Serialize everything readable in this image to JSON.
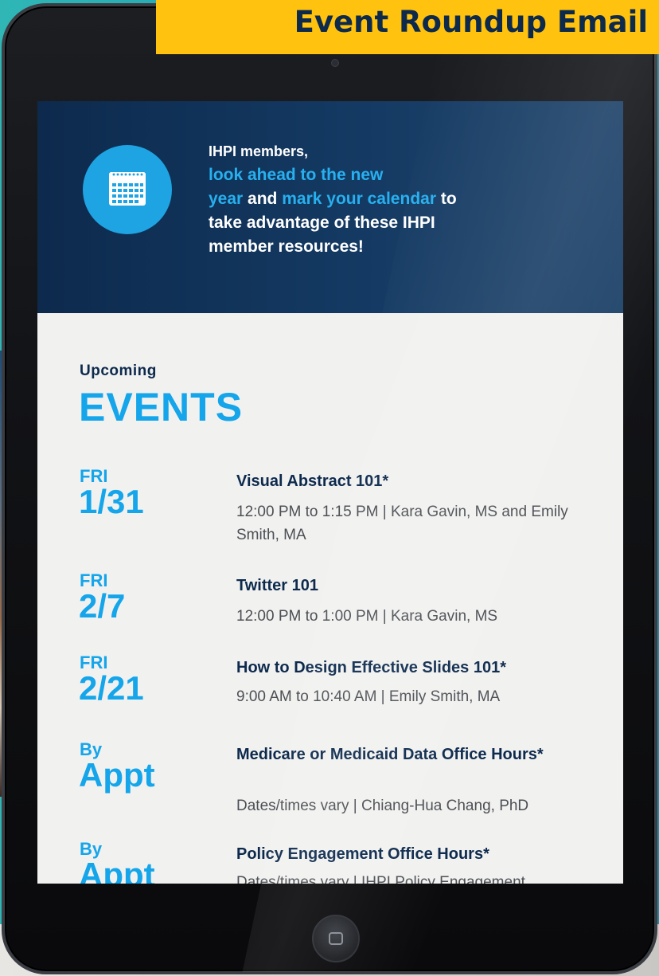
{
  "banner": {
    "title": "Event Roundup Email",
    "background": "#ffc20e",
    "text_color": "#0d2a4d"
  },
  "hero": {
    "line1": "IHPI members,",
    "line2": "look ahead to the new",
    "line3_a": "year",
    "line3_b": " and ",
    "line3_c": "mark your calendar",
    "line3_d": " to",
    "line4": "take advantage of these IHPI",
    "line5": "member resources!",
    "icon": "calendar-icon",
    "colors": {
      "background": "#0d2a4d",
      "highlight": "#27b0ef"
    }
  },
  "events_section": {
    "subheading": "Upcoming",
    "heading": "EVENTS",
    "items": [
      {
        "day": "FRI",
        "date": "1/31",
        "title": "Visual Abstract 101*",
        "detail": "12:00 PM to 1:15 PM | Kara Gavin, MS and Emily Smith, MA"
      },
      {
        "day": "FRI",
        "date": "2/7",
        "title": "Twitter 101",
        "detail": "12:00 PM to 1:00 PM | Kara Gavin, MS"
      },
      {
        "day": "FRI",
        "date": "2/21",
        "title": "How to Design Effective Slides 101*",
        "detail": "9:00 AM to 10:40 AM | Emily Smith, MA"
      },
      {
        "day": "By",
        "date": "Appt",
        "title": "Medicare or Medicaid Data Office Hours*",
        "detail": "Dates/times vary | Chiang-Hua Chang, PhD"
      },
      {
        "day": "By",
        "date": "Appt",
        "title": "Policy Engagement Office Hours*",
        "detail": "Dates/times vary | IHPI Policy Engagement"
      }
    ]
  },
  "device": {
    "home_button_icon": "home-button-icon"
  }
}
